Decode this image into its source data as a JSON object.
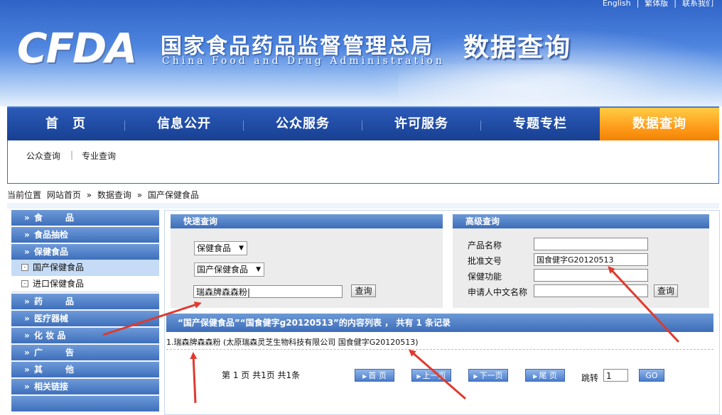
{
  "top_links": [
    "English",
    "|",
    "繁体版",
    "|",
    "联系我们"
  ],
  "header": {
    "logo": "CFDA",
    "cn_title": "国家食品药品监督管理总局",
    "en_title": "China Food and Drug Administration",
    "data_title": "数据查询"
  },
  "nav": {
    "items": [
      "首　页",
      "信息公开",
      "公众服务",
      "许可服务",
      "专题专栏",
      "数据查询"
    ]
  },
  "subnav": {
    "items": [
      "公众查询",
      "专业查询"
    ],
    "sep": "|"
  },
  "breadcrumb": {
    "label": "当前位置",
    "items": [
      "网站首页",
      "»",
      "数据查询",
      "»",
      "国产保健食品"
    ]
  },
  "sidebar": {
    "menus": [
      {
        "label": "食　品"
      },
      {
        "label": "食品抽检"
      },
      {
        "label": "保健食品"
      }
    ],
    "submenus": [
      {
        "label": "国产保健食品"
      },
      {
        "label": "进口保健食品"
      }
    ],
    "menus2": [
      {
        "label": "药　品"
      },
      {
        "label": "医疗器械"
      },
      {
        "label": "化 妆 品"
      },
      {
        "label": "广　告"
      },
      {
        "label": "其　他"
      },
      {
        "label": "相关链接"
      }
    ],
    "chev": "»"
  },
  "quick": {
    "title": "快速查询",
    "select1": "保健食品",
    "select2": "国产保健食品",
    "input": "瑞森牌森森粉|",
    "button": "查询"
  },
  "advanced": {
    "title": "高级查询",
    "labels": [
      "产品名称",
      "批准文号",
      "保健功能",
      "申请人中文名称"
    ],
    "values": [
      "",
      "国食健字G20120513",
      "",
      ""
    ],
    "button": "查询"
  },
  "result": {
    "header": "“国产保健食品”“国食健字g20120513”的内容列表 ，  共有 1 条记录",
    "row": "1.瑞森牌森森粉 (太原瑞森灵芝生物科技有限公司 国食健字G20120513)"
  },
  "pager": {
    "info": "第 1 页 共1页 共1条",
    "first": "首 页",
    "prev": "上一页",
    "next": "下一页",
    "last": "尾 页",
    "jump_label": "跳转",
    "jump_value": "1",
    "go": "GO"
  },
  "colors": {
    "accent": "#3d6db9",
    "active_nav": "#ff9a1a",
    "annotation": "#e03a2e"
  }
}
